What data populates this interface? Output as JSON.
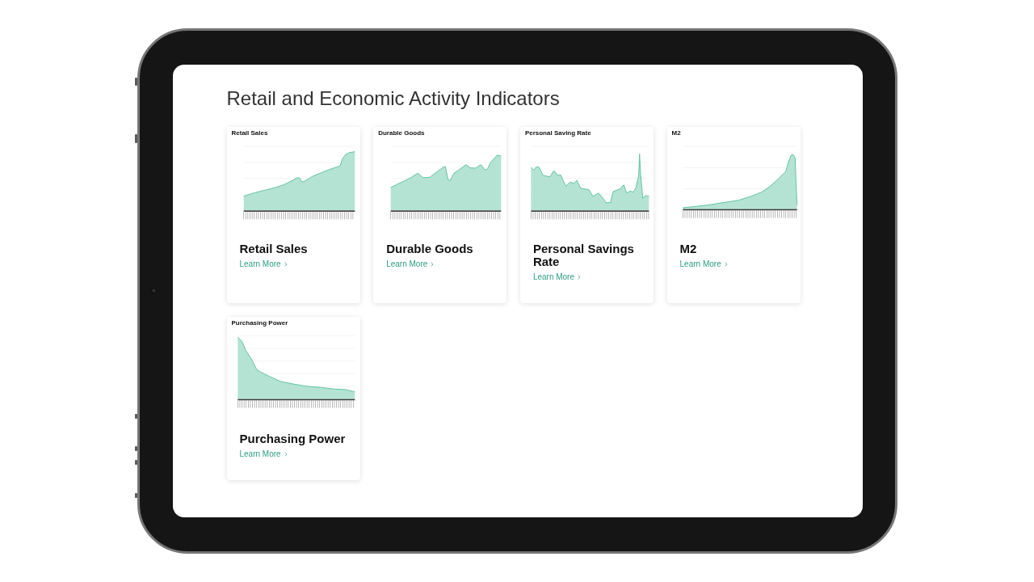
{
  "screen": {
    "title": "Retail and Economic Activity Indicators"
  },
  "cards": [
    {
      "title": "Retail Sales",
      "link": "Learn More",
      "chart": {
        "title": "Retail Sales",
        "kind": "growth"
      }
    },
    {
      "title": "Durable Goods",
      "link": "Learn More",
      "chart": {
        "title": "Durable Goods",
        "kind": "cyclical"
      }
    },
    {
      "title": "Personal Savings Rate",
      "link": "Learn More",
      "chart": {
        "title": "Personal Saving Rate",
        "kind": "volatile"
      }
    },
    {
      "title": "M2",
      "link": "Learn More",
      "chart": {
        "title": "M2",
        "kind": "exponential"
      }
    },
    {
      "title": "Purchasing Power",
      "link": "Learn More",
      "chart": {
        "title": "Purchasing Power",
        "kind": "decay"
      }
    }
  ]
}
